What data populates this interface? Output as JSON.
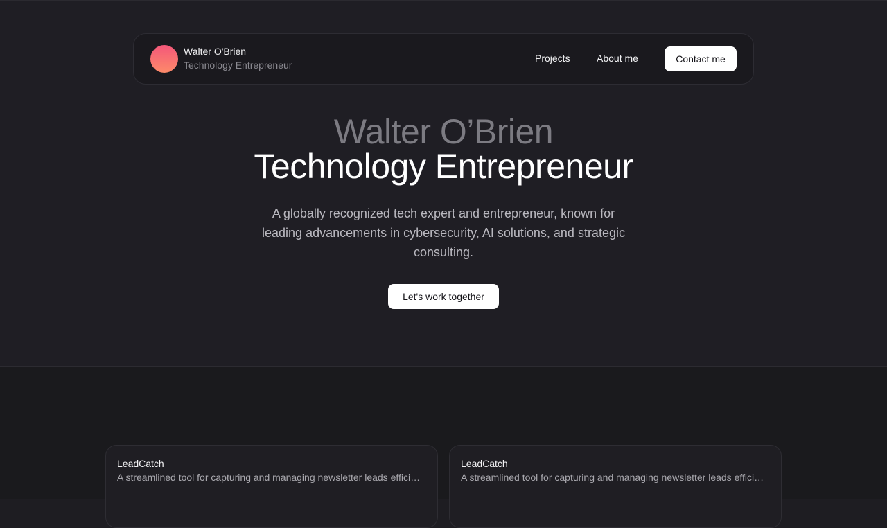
{
  "navbar": {
    "name": "Walter O'Brien",
    "subtitle": "Technology Entrepreneur",
    "links": [
      "Projects",
      "About me"
    ],
    "contact_label": "Contact me"
  },
  "hero": {
    "title_line1": "Walter O’Brien",
    "title_line2": "Technology Entrepreneur",
    "description": "A globally recognized tech expert and entrepreneur, known for leading advancements in cybersecurity, AI solutions, and strategic consulting.",
    "cta_label": "Let's work together"
  },
  "projects": [
    {
      "title": "LeadCatch",
      "description": "A streamlined tool for capturing and managing newsletter leads efficiently."
    },
    {
      "title": "LeadCatch",
      "description": "A streamlined tool for capturing and managing newsletter leads efficiently."
    }
  ],
  "colors": {
    "background": "#1f1e24",
    "avatar_gradient_start": "#f4577a",
    "avatar_gradient_end": "#fd8a6a",
    "button_bg": "#ffffff",
    "muted_text": "#7c7b82"
  }
}
